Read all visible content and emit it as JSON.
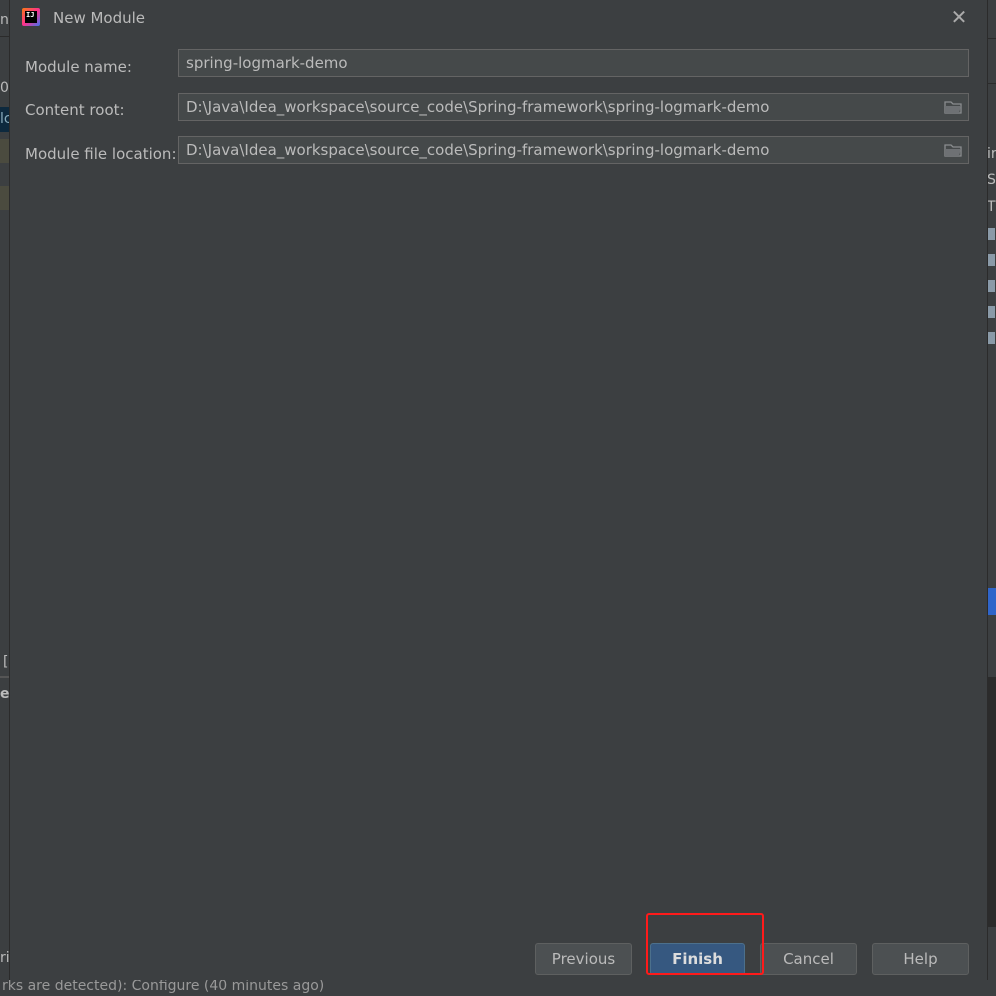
{
  "dialog": {
    "title": "New Module",
    "close_glyph": "✕",
    "app_icon_text": "IJ"
  },
  "form": {
    "module_name": {
      "label": "Module name:",
      "value": "spring-logmark-demo"
    },
    "content_root": {
      "label": "Content root:",
      "value": "D:\\Java\\Idea_workspace\\source_code\\Spring-framework\\spring-logmark-demo"
    },
    "module_file_location": {
      "label": "Module file location:",
      "value": "D:\\Java\\Idea_workspace\\source_code\\Spring-framework\\spring-logmark-demo"
    }
  },
  "buttons": {
    "previous": "Previous",
    "finish": "Finish",
    "cancel": "Cancel",
    "help": "Help"
  },
  "background": {
    "left_fragments": [
      "ne",
      "0",
      "lc",
      "[",
      "e",
      "ri"
    ],
    "right_fragments": [
      "ir",
      "S",
      "T"
    ],
    "status_line": "rks are detected): Configure (40 minutes ago)"
  },
  "colors": {
    "primary_button": "#365880",
    "highlight_box": "#ff1a1a",
    "selection": "#2f65ca"
  },
  "icons": [
    "app-icon",
    "close-icon",
    "folder-icon"
  ]
}
